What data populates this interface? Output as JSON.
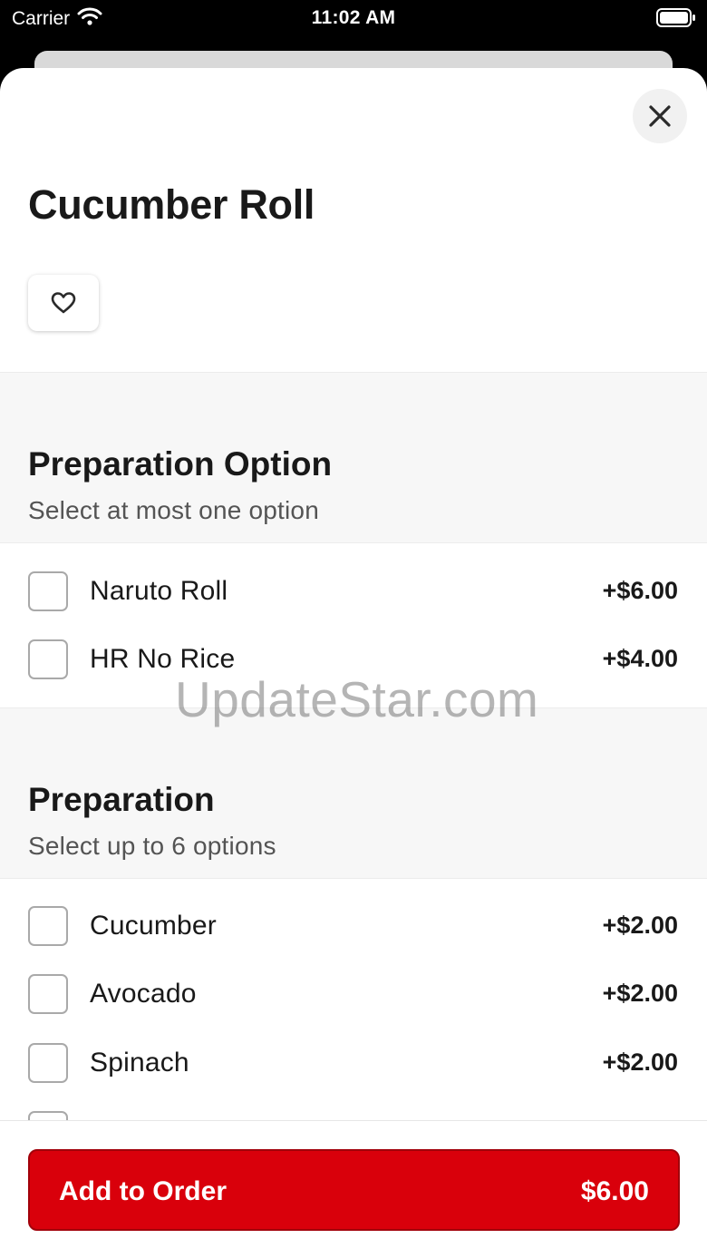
{
  "status_bar": {
    "carrier": "Carrier",
    "time": "11:02 AM"
  },
  "item": {
    "title": "Cucumber Roll"
  },
  "sections": [
    {
      "title": "Preparation Option",
      "subtitle": "Select at most one option",
      "options": [
        {
          "label": "Naruto Roll",
          "price": "+$6.00",
          "checked": false
        },
        {
          "label": "HR No Rice",
          "price": "+$4.00",
          "checked": false
        }
      ]
    },
    {
      "title": "Preparation",
      "subtitle": "Select up to 6 options",
      "options": [
        {
          "label": "Cucumber",
          "price": "+$2.00",
          "checked": false
        },
        {
          "label": "Avocado",
          "price": "+$2.00",
          "checked": false
        },
        {
          "label": "Spinach",
          "price": "+$2.00",
          "checked": false
        }
      ]
    }
  ],
  "footer": {
    "button_label": "Add to Order",
    "button_price": "$6.00"
  },
  "watermark": "UpdateStar.com",
  "colors": {
    "accent": "#d9000b",
    "section_background": "#f7f7f7"
  },
  "icons": {
    "close": "close-icon",
    "favorite": "heart-outline-icon",
    "wifi": "wifi-icon",
    "battery": "battery-icon"
  }
}
